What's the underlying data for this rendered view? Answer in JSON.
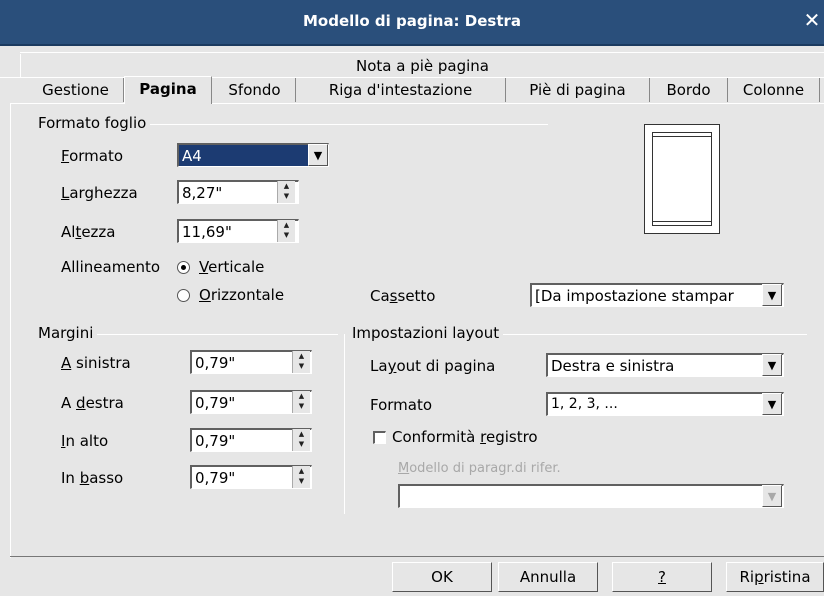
{
  "window": {
    "title": "Modello di pagina: Destra",
    "close": "✕"
  },
  "tabs_row1": [
    {
      "label": "Nota a piè pagina"
    }
  ],
  "tabs_row2": [
    {
      "label": "Gestione"
    },
    {
      "label": "Pagina",
      "active": true
    },
    {
      "label": "Sfondo"
    },
    {
      "label": "Riga d'intestazione"
    },
    {
      "label": "Piè di pagina"
    },
    {
      "label": "Bordo"
    },
    {
      "label": "Colonne"
    }
  ],
  "paper_format": {
    "group_label": "Formato foglio",
    "format_label": "Formato",
    "format_value": "A4",
    "width_label": "Larghezza",
    "width_value": "8,27\"",
    "height_label": "Altezza",
    "height_value": "11,69\"",
    "orientation_label": "Allineamento",
    "portrait_label": "Verticale",
    "landscape_label": "Orizzontale",
    "orientation_selected": "portrait",
    "tray_label": "Cassetto",
    "tray_value": "[Da impostazione stampar"
  },
  "margins": {
    "group_label": "Margini",
    "left_label": "A sinistra",
    "left_value": "0,79\"",
    "right_label": "A destra",
    "right_value": "0,79\"",
    "top_label": "In alto",
    "top_value": "0,79\"",
    "bottom_label": "In basso",
    "bottom_value": "0,79\""
  },
  "layout": {
    "group_label": "Impostazioni layout",
    "page_layout_label": "Layout di pagina",
    "page_layout_value": "Destra e sinistra",
    "format_label": "Formato",
    "format_value": "1, 2, 3, ...",
    "register_label": "Conformità registro",
    "register_checked": false,
    "reference_style_label": "Modello di paragr.di rifer.",
    "reference_style_value": ""
  },
  "buttons": {
    "ok": "OK",
    "cancel": "Annulla",
    "help": "?",
    "reset": "Ripristina"
  },
  "icons": {
    "dropdown": "▼",
    "spin_up": "▲",
    "spin_down": "▼"
  },
  "colors": {
    "titlebar": "#2a4f7b",
    "selection": "#1c3b72",
    "dialog_bg": "#e6e6e6"
  }
}
